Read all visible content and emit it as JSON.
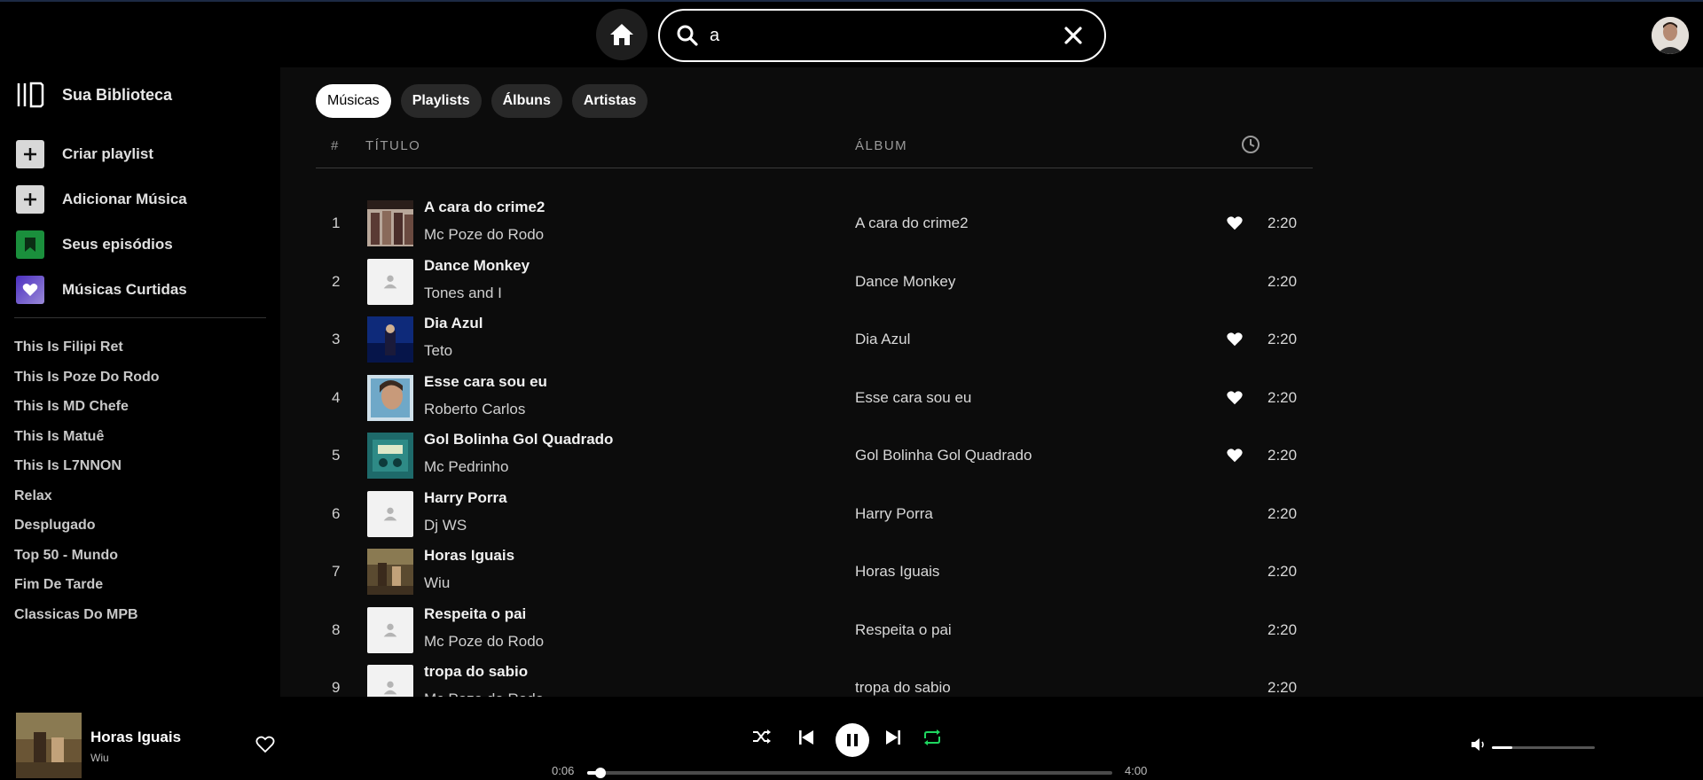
{
  "search": {
    "value": "a",
    "placeholder": ""
  },
  "sidebar": {
    "library_label": "Sua Biblioteca",
    "menu": [
      {
        "label": "Criar playlist",
        "icon": "plus-icon",
        "color": "#d8d8d8"
      },
      {
        "label": "Adicionar Música",
        "icon": "plus-icon",
        "color": "#d8d8d8"
      },
      {
        "label": "Seus episódios",
        "icon": "bookmark-icon",
        "color": "#1a8f3c"
      },
      {
        "label": "Músicas Curtidas",
        "icon": "heart-icon",
        "color": "#5a3fc8"
      }
    ],
    "playlists": [
      "This Is Filipi Ret",
      "This Is Poze Do Rodo",
      "This Is MD Chefe",
      "This Is Matuê",
      "This Is L7NNON",
      "Relax",
      "Desplugado",
      "Top 50 - Mundo",
      "Fim De Tarde",
      "Classicas Do MPB"
    ]
  },
  "filters": [
    "Músicas",
    "Playlists",
    "Álbuns",
    "Artistas"
  ],
  "table": {
    "col_num": "#",
    "col_title": "TÍTULO",
    "col_album": "ÁLBUM",
    "tracks": [
      {
        "num": "1",
        "title": "A cara do crime2",
        "artist": "Mc Poze do Rodo",
        "album": "A cara do crime2",
        "liked": true,
        "duration": "2:20",
        "art": "group"
      },
      {
        "num": "2",
        "title": "Dance Monkey",
        "artist": "Tones and I",
        "album": "Dance Monkey",
        "liked": false,
        "duration": "2:20",
        "art": "blank"
      },
      {
        "num": "3",
        "title": "Dia Azul",
        "artist": "Teto",
        "album": "Dia Azul",
        "liked": true,
        "duration": "2:20",
        "art": "blue"
      },
      {
        "num": "4",
        "title": "Esse cara sou eu",
        "artist": "Roberto Carlos",
        "album": "Esse cara sou eu",
        "liked": true,
        "duration": "2:20",
        "art": "portrait"
      },
      {
        "num": "5",
        "title": "Gol Bolinha Gol Quadrado",
        "artist": "Mc Pedrinho",
        "album": "Gol Bolinha Gol Quadrado",
        "liked": true,
        "duration": "2:20",
        "art": "teal"
      },
      {
        "num": "6",
        "title": "Harry Porra",
        "artist": "Dj WS",
        "album": "Harry Porra",
        "liked": false,
        "duration": "2:20",
        "art": "blank"
      },
      {
        "num": "7",
        "title": "Horas Iguais",
        "artist": "Wiu",
        "album": "Horas Iguais",
        "liked": false,
        "duration": "2:20",
        "art": "forest"
      },
      {
        "num": "8",
        "title": "Respeita o pai",
        "artist": "Mc Poze do Rodo",
        "album": "Respeita o pai",
        "liked": false,
        "duration": "2:20",
        "art": "blank"
      },
      {
        "num": "9",
        "title": "tropa do sabio",
        "artist": "Mc Poze do Rodo",
        "album": "tropa do sabio",
        "liked": false,
        "duration": "2:20",
        "art": "blank"
      }
    ]
  },
  "player": {
    "title": "Horas Iguais",
    "artist": "Wiu",
    "current_time": "0:06",
    "total_time": "4:00",
    "progress": 0.025,
    "volume": 0.2,
    "repeat_color": "#1ed760"
  }
}
